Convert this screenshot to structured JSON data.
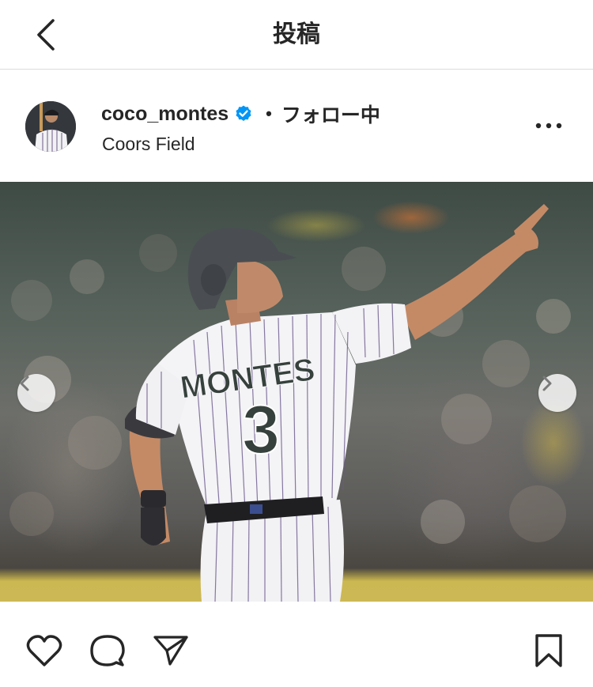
{
  "header": {
    "title": "投稿",
    "back_icon": "chevron-left-icon"
  },
  "post": {
    "username": "coco_montes",
    "verified": true,
    "separator": "•",
    "follow_status": "フォロー中",
    "location": "Coors Field",
    "more_icon": "more-horizontal-icon"
  },
  "photo": {
    "jersey_name": "MONTES",
    "jersey_number": "3",
    "carousel": {
      "prev_icon": "chevron-left-icon",
      "next_icon": "chevron-right-icon"
    }
  },
  "actions": {
    "like_icon": "heart-icon",
    "comment_icon": "comment-icon",
    "share_icon": "send-icon",
    "save_icon": "bookmark-icon"
  },
  "colors": {
    "verified_blue": "#0095f6",
    "text": "#262626",
    "divider": "#dbdbdb"
  }
}
